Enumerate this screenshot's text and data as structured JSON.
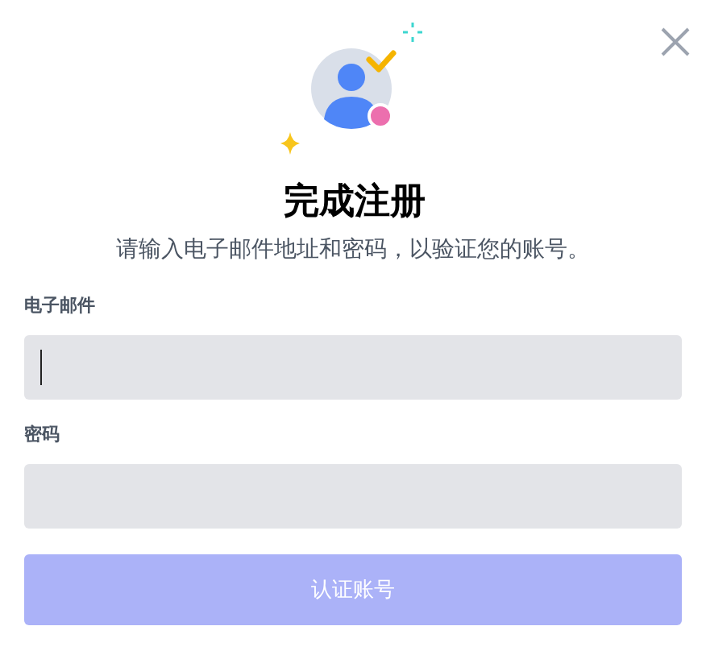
{
  "dialog": {
    "title": "完成注册",
    "subtitle": "请输入电子邮件地址和密码，以验证您的账号。"
  },
  "fields": [
    {
      "label": "电子邮件",
      "focused": true
    },
    {
      "label": "密码",
      "focused": false
    }
  ],
  "submit": {
    "label": "认证账号",
    "disabled": true
  }
}
